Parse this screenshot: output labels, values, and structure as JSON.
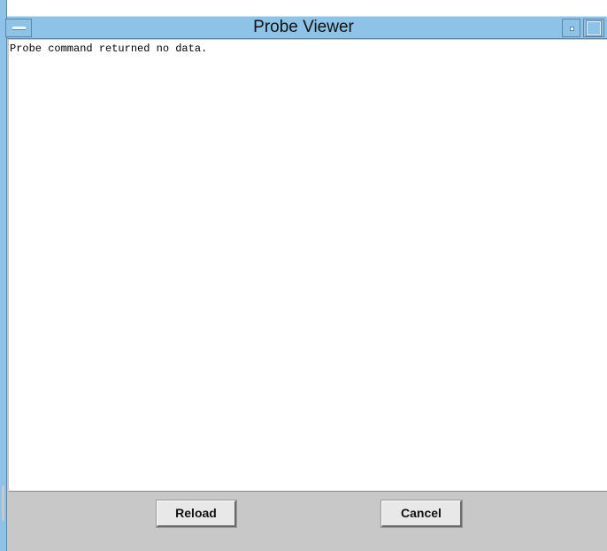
{
  "window": {
    "title": "Probe Viewer"
  },
  "output": {
    "text": "Probe command returned no data."
  },
  "buttons": {
    "reload_label": "Reload",
    "cancel_label": "Cancel"
  },
  "icons": {
    "menu": "window-menu-icon",
    "minimize": "minimize-icon",
    "maximize": "maximize-icon"
  },
  "colors": {
    "title_bar": "#8ec3e8",
    "content_background": "#ffffff",
    "panel_background": "#c8c8c8"
  }
}
